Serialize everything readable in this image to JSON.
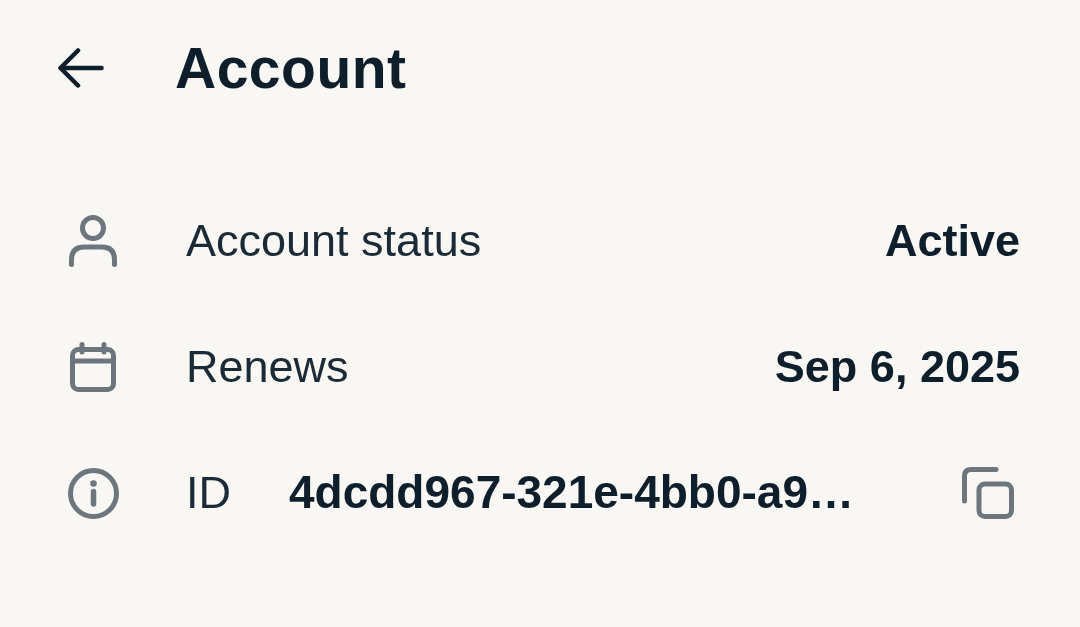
{
  "header": {
    "title": "Account"
  },
  "rows": [
    {
      "kind": "value",
      "label": "Account status",
      "value": "Active"
    },
    {
      "kind": "value",
      "label": "Renews",
      "value": "Sep 6, 2025"
    },
    {
      "kind": "copyable",
      "label": "ID",
      "value": "4dcdd967-321e-4bb0-a9…"
    }
  ]
}
